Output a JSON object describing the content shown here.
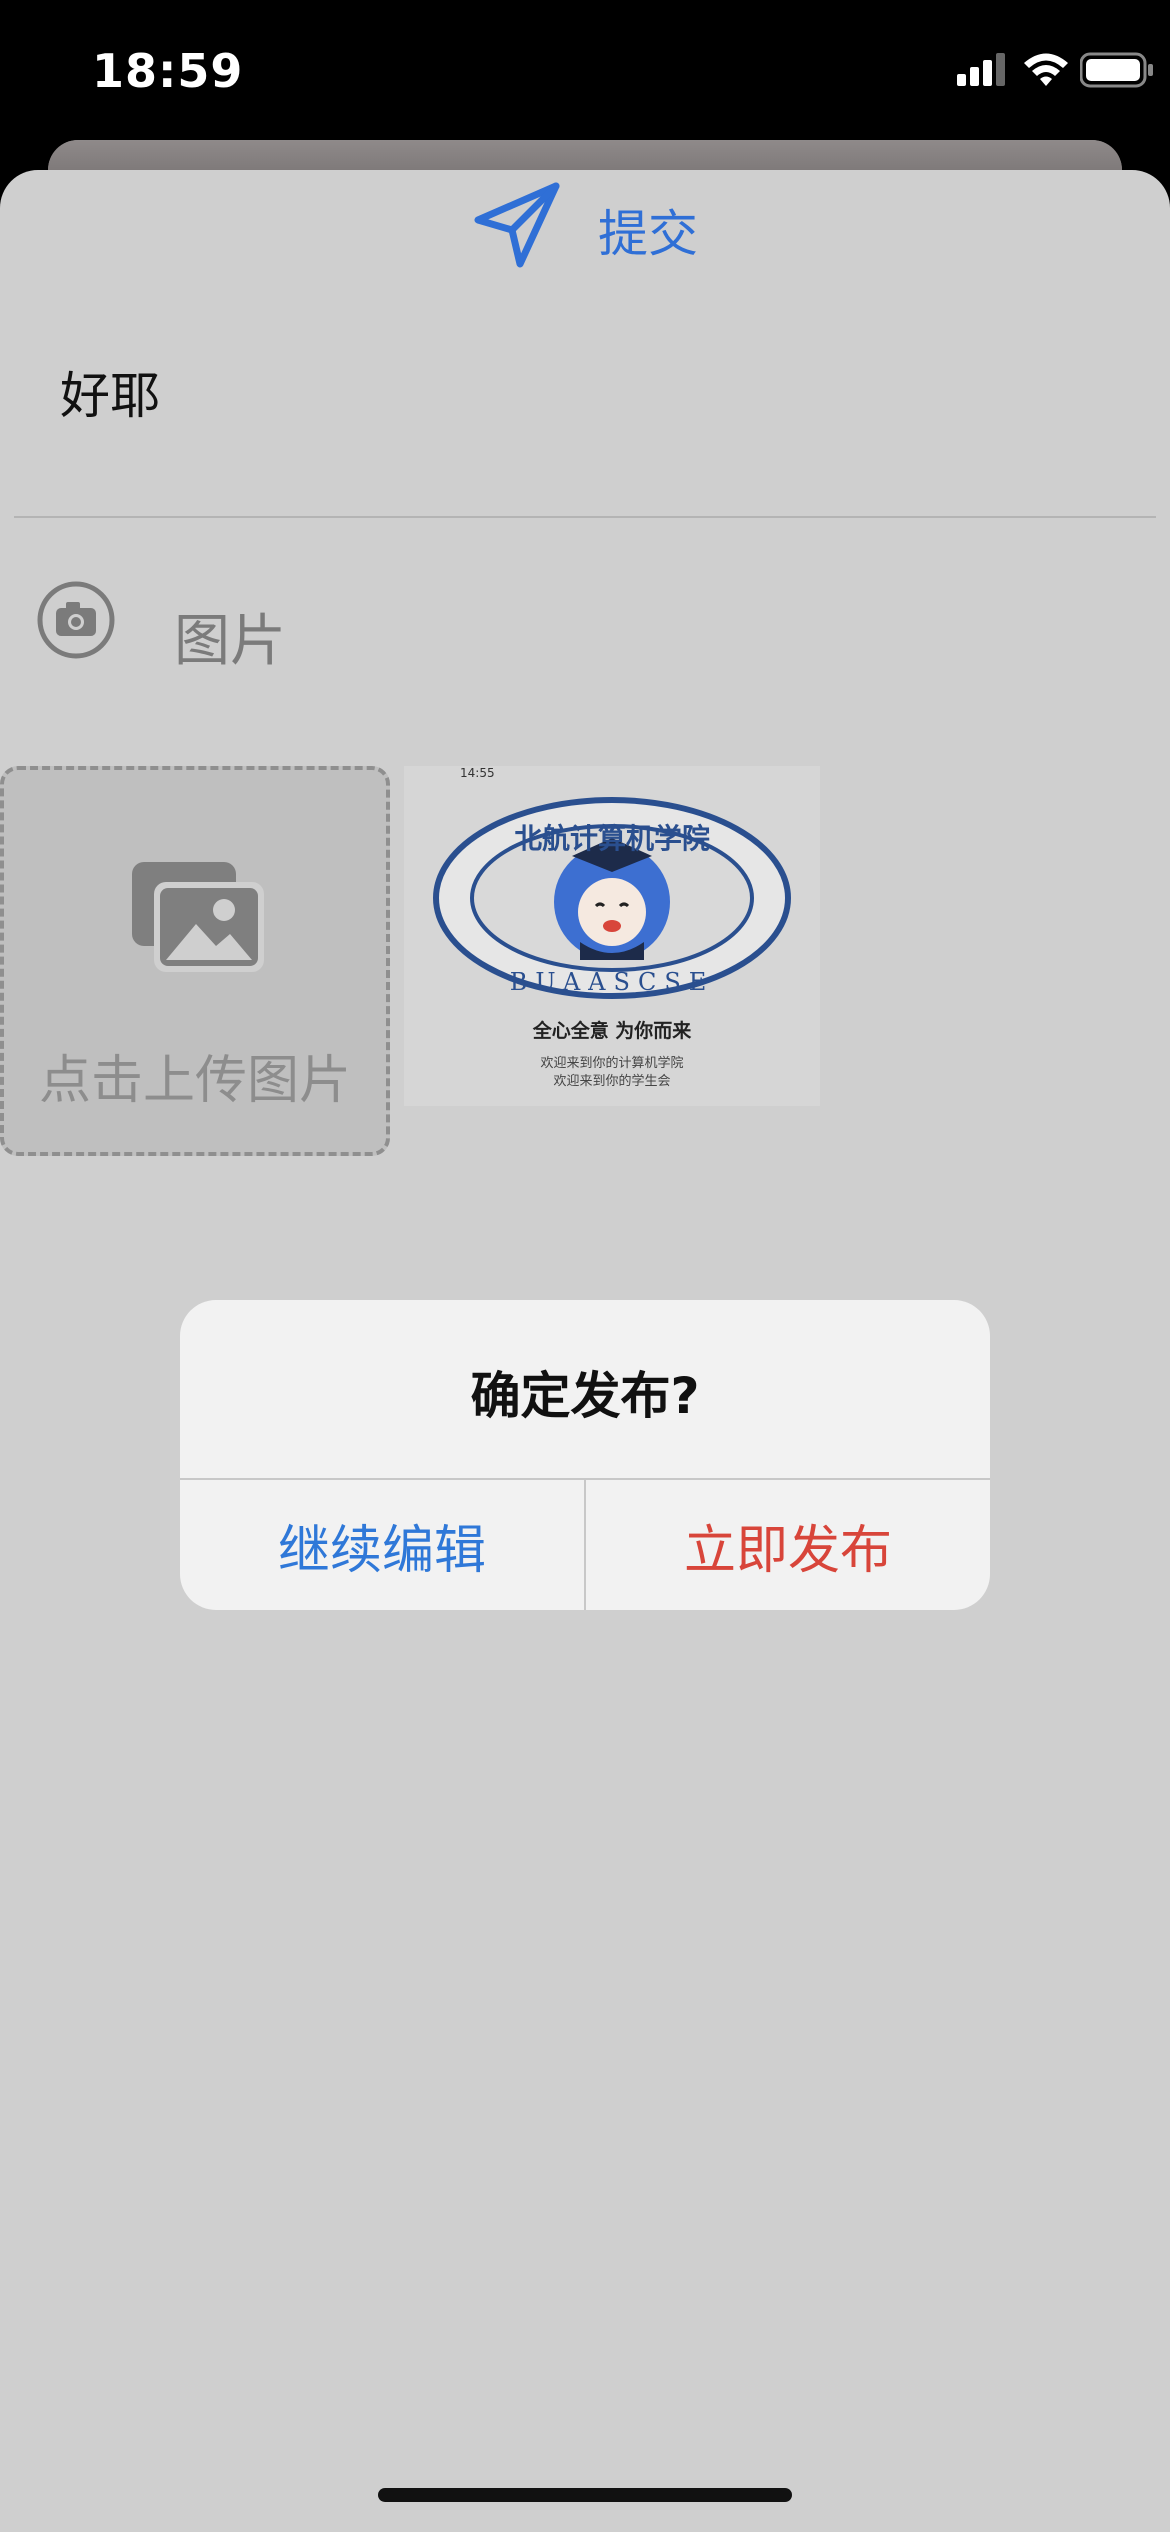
{
  "status_bar": {
    "time": "18:59"
  },
  "header": {
    "submit_label": "提交"
  },
  "post": {
    "text": "好耶"
  },
  "image_section": {
    "label": "图片",
    "upload_label": "点击上传图片"
  },
  "thumbnail": {
    "status_time": "14:55",
    "ring_text_top": "北航计算机学院",
    "ring_text_bottom": "BUAASCSE",
    "slogan": "全心全意 为你而来",
    "line1": "欢迎来到你的计算机学院",
    "line2": "欢迎来到你的学生会"
  },
  "dialog": {
    "title": "确定发布?",
    "continue_label": "继续编辑",
    "publish_label": "立即发布"
  },
  "colors": {
    "accent": "#2f6fd6",
    "destructive": "#d8453a",
    "overlay": "#cfcfcf"
  }
}
